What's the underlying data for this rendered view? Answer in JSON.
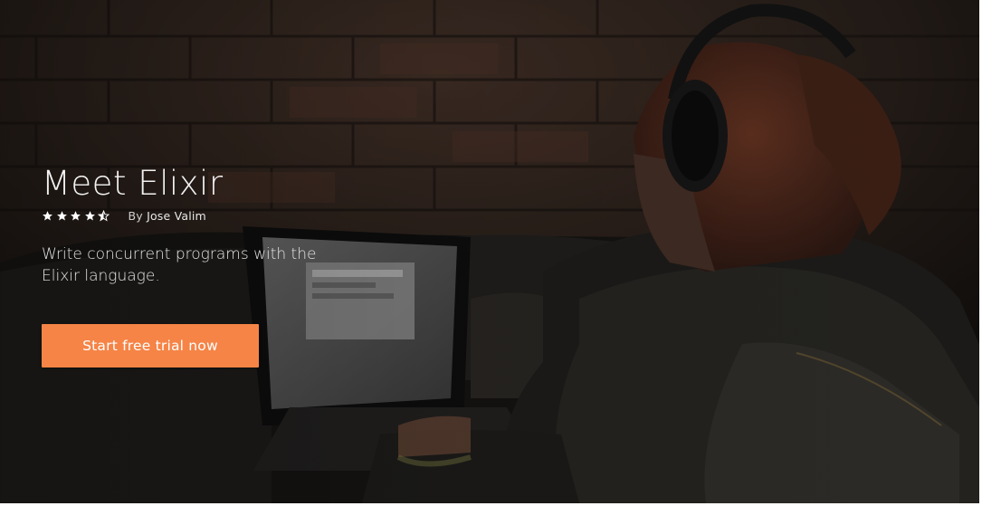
{
  "hero": {
    "title": "Meet Elixir",
    "rating": {
      "value": 4.5,
      "max": 5
    },
    "byline_prefix": "By",
    "author": "Jose Valim",
    "description": "Write concurrent programs with the Elixir language.",
    "cta_label": "Start free trial now"
  },
  "colors": {
    "cta_background": "#f58446",
    "title_text": "#f3f3f3",
    "star_color": "#ffffff"
  },
  "icons": {
    "star_full": "star-icon",
    "star_half": "star-half-icon"
  }
}
